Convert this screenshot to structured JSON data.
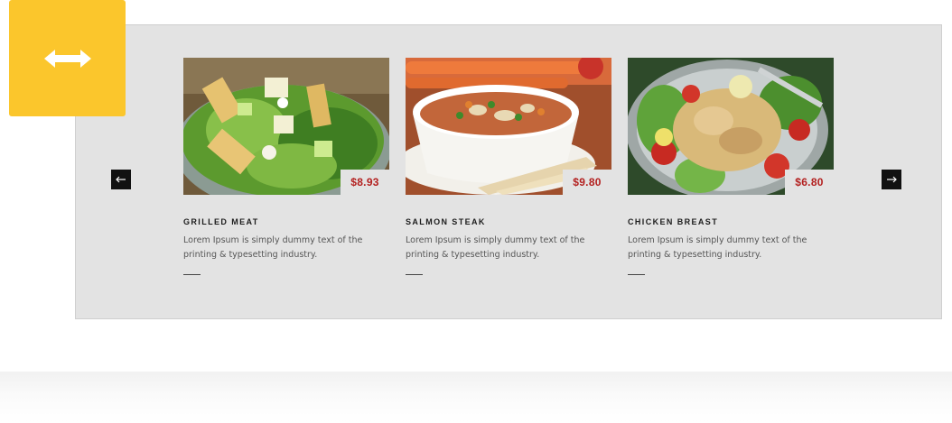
{
  "badge": {
    "icon": "horizontal-resize-icon",
    "color": "#fbc62c"
  },
  "slider": {
    "prev_icon": "arrow-left-icon",
    "next_icon": "arrow-right-icon",
    "items": [
      {
        "title": "GRILLED MEAT",
        "price": "$8.93",
        "description": "Lorem Ipsum is simply dummy text of the printing & typesetting industry.",
        "image": "salad-photo"
      },
      {
        "title": "SALMON STEAK",
        "price": "$9.80",
        "description": "Lorem Ipsum is simply dummy text of the printing & typesetting industry.",
        "image": "soup-photo"
      },
      {
        "title": "CHICKEN BREAST",
        "price": "$6.80",
        "description": "Lorem Ipsum is simply dummy text of the printing & typesetting industry.",
        "image": "pasta-salad-photo"
      }
    ]
  },
  "colors": {
    "price": "#b3201f",
    "panel": "#e3e3e3",
    "arrow_bg": "#111111"
  }
}
